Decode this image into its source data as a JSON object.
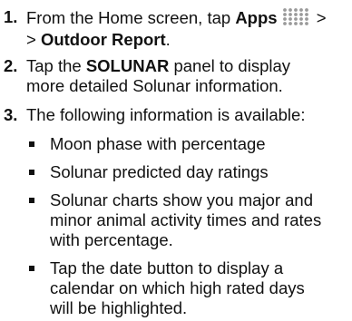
{
  "steps": [
    {
      "number": "1.",
      "line1_prefix": "From the Home screen, tap ",
      "line1_bold": "Apps",
      "line1_suffix": " >",
      "line2_prefix": "> ",
      "line2_bold": "Outdoor Report",
      "line2_suffix": "."
    },
    {
      "number": "2.",
      "line1_prefix": "Tap the ",
      "line1_bold": "SOLUNAR",
      "line1_suffix": " panel to display",
      "line2": "more detailed Solunar information."
    },
    {
      "number": "3.",
      "line1": "The following information is available:"
    }
  ],
  "bullets": [
    {
      "lines": [
        "Moon phase with percentage"
      ]
    },
    {
      "lines": [
        "Solunar predicted day ratings"
      ]
    },
    {
      "lines": [
        "Solunar charts show you major and",
        "minor animal activity times and rates",
        "with percentage."
      ]
    },
    {
      "lines": [
        "Tap the date button to display a",
        "calendar on which high rated days",
        "will be highlighted."
      ]
    }
  ],
  "icons": {
    "apps": "apps-grid-icon"
  },
  "colors": {
    "text": "#111111",
    "icon": "#9a9a9a"
  }
}
